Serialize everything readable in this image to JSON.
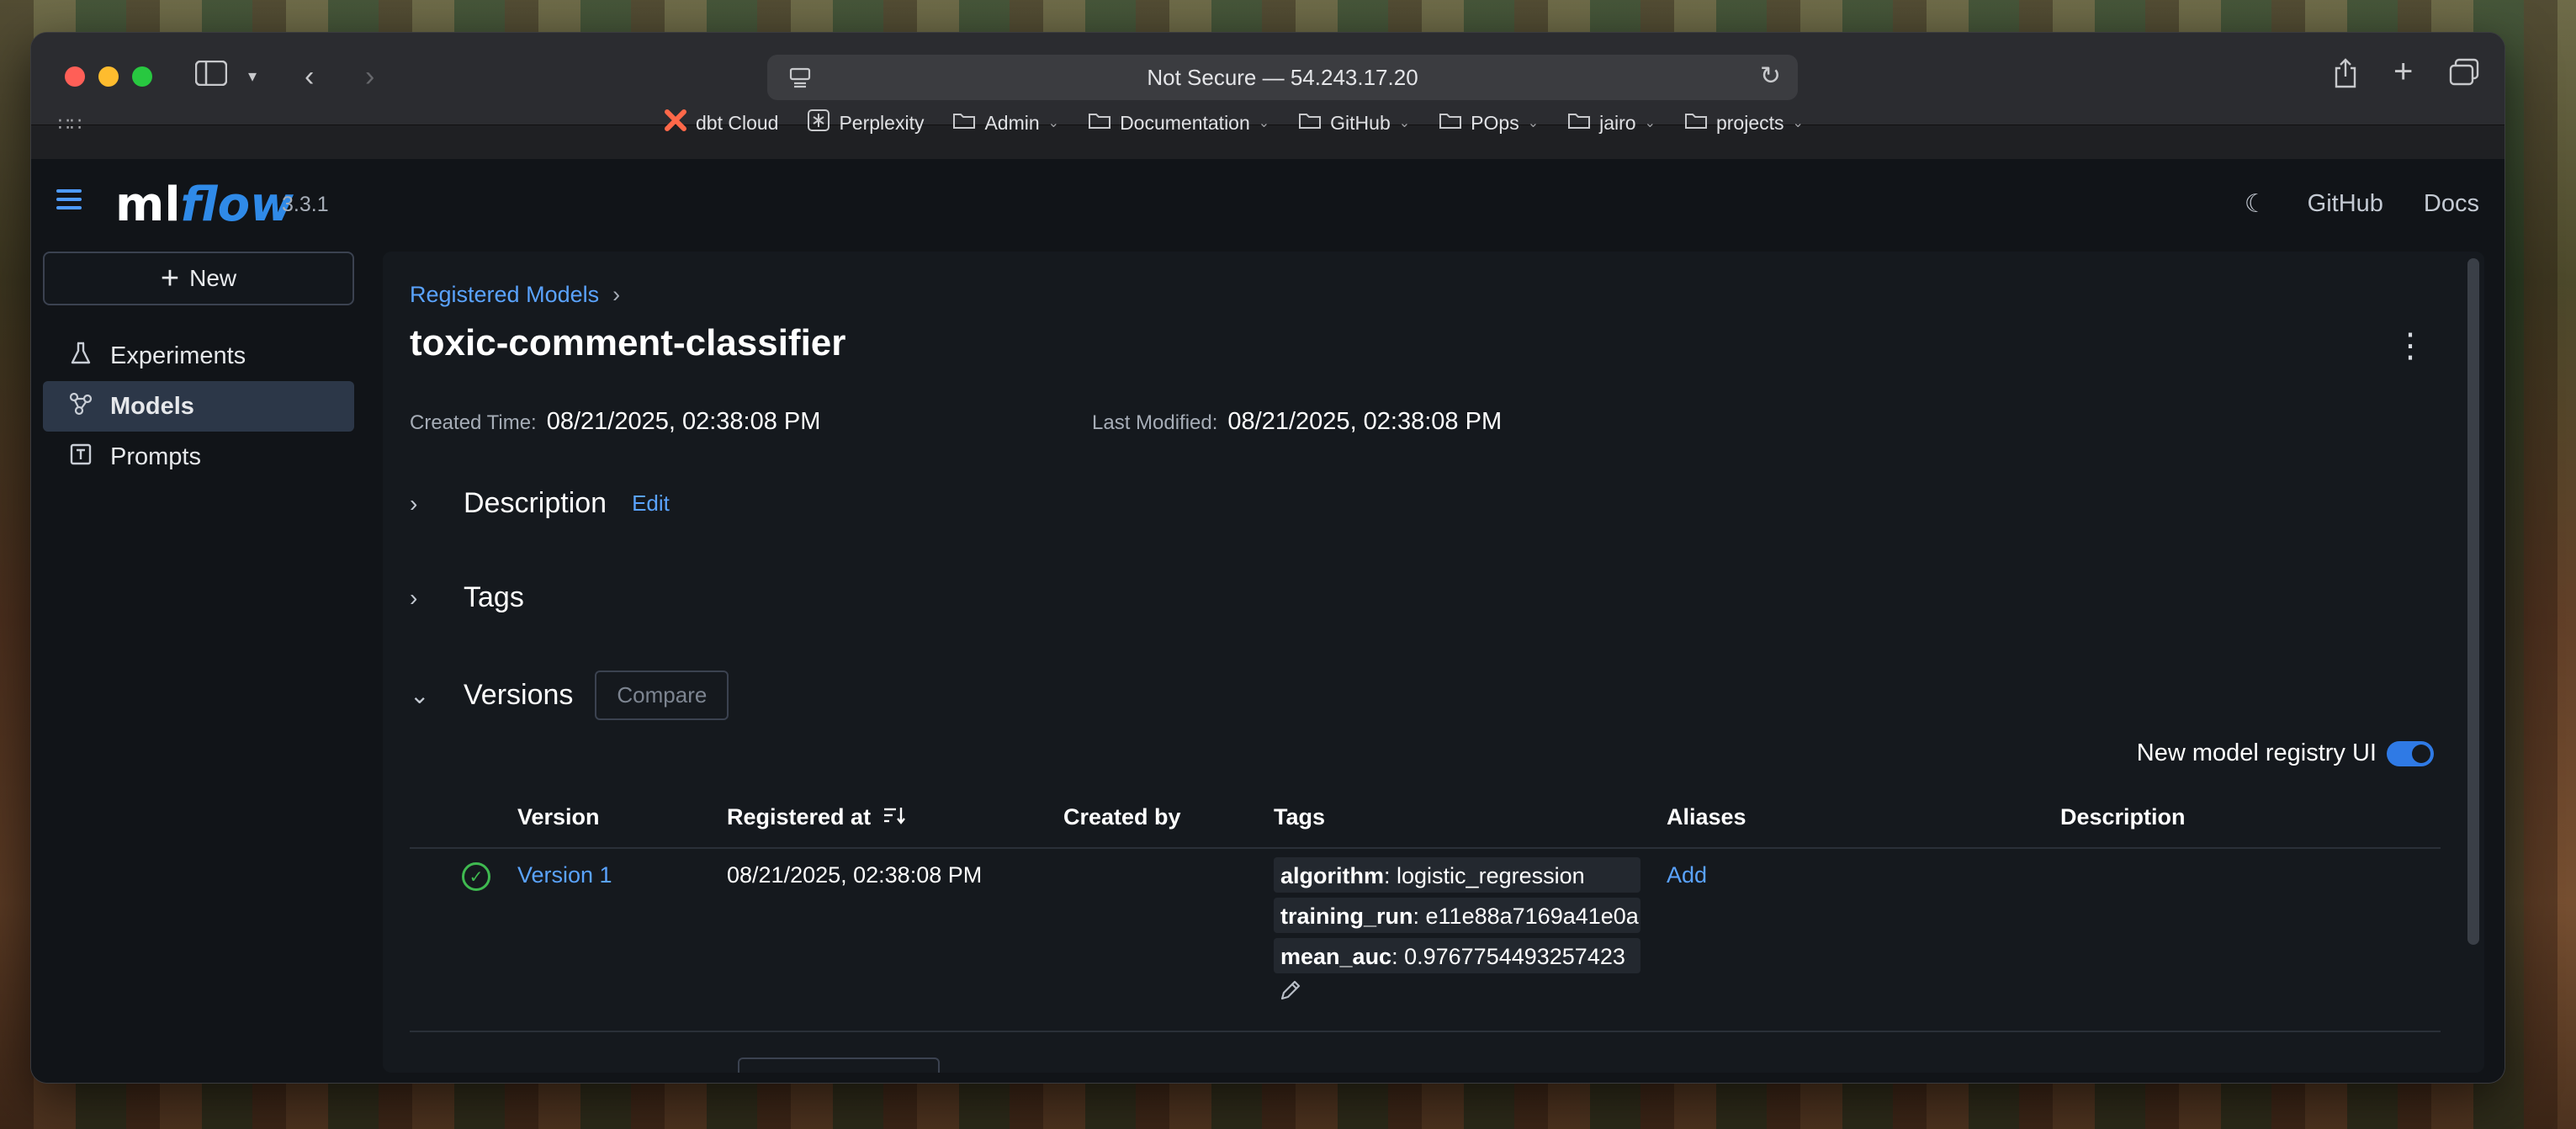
{
  "browser": {
    "url_text": "Not Secure — 54.243.17.20",
    "bookmarks": [
      {
        "label": "dbt Cloud",
        "icon": "dbt-icon",
        "folder": false
      },
      {
        "label": "Perplexity",
        "icon": "perplexity-icon",
        "folder": false
      },
      {
        "label": "Admin",
        "icon": "folder-icon",
        "folder": true
      },
      {
        "label": "Documentation",
        "icon": "folder-icon",
        "folder": true
      },
      {
        "label": "GitHub",
        "icon": "folder-icon",
        "folder": true
      },
      {
        "label": "POps",
        "icon": "folder-icon",
        "folder": true
      },
      {
        "label": "jairo",
        "icon": "folder-icon",
        "folder": true
      },
      {
        "label": "projects",
        "icon": "folder-icon",
        "folder": true
      }
    ]
  },
  "app": {
    "logo_ml": "ml",
    "logo_flow": "flow",
    "version": "3.3.1",
    "nav_github": "GitHub",
    "nav_docs": "Docs"
  },
  "sidebar": {
    "new_label": "New",
    "items": [
      {
        "label": "Experiments",
        "icon": "flask-icon"
      },
      {
        "label": "Models",
        "icon": "models-icon"
      },
      {
        "label": "Prompts",
        "icon": "prompt-icon"
      }
    ]
  },
  "model": {
    "breadcrumb": "Registered Models",
    "name": "toxic-comment-classifier",
    "created_label": "Created Time:",
    "created_value": "08/21/2025, 02:38:08 PM",
    "modified_label": "Last Modified:",
    "modified_value": "08/21/2025, 02:38:08 PM",
    "description_label": "Description",
    "edit_label": "Edit",
    "tags_label": "Tags",
    "versions_label": "Versions",
    "compare_label": "Compare",
    "toggle_label": "New model registry UI"
  },
  "table": {
    "headers": {
      "version": "Version",
      "registered": "Registered at",
      "created_by": "Created by",
      "tags": "Tags",
      "aliases": "Aliases",
      "description": "Description"
    },
    "rows": [
      {
        "version": "Version 1",
        "registered": "08/21/2025, 02:38:08 PM",
        "created_by": "",
        "tags": [
          {
            "key": "algorithm",
            "value": "logistic_regression"
          },
          {
            "key": "training_run",
            "value": "e11e88a7169a41e0a"
          },
          {
            "key": "mean_auc",
            "value": "0.9767754493257423"
          }
        ],
        "alias_action": "Add",
        "description": ""
      }
    ]
  }
}
